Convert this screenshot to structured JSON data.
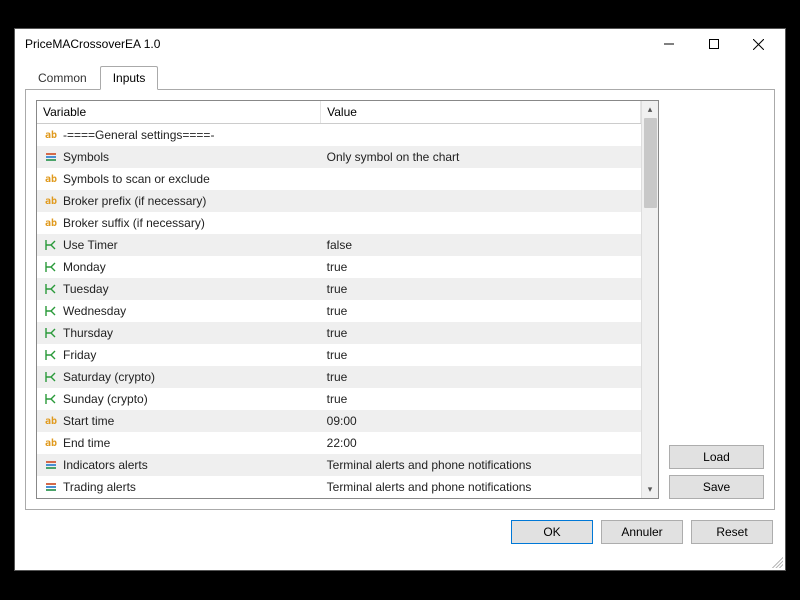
{
  "window": {
    "title": "PriceMACrossoverEA 1.0"
  },
  "tabs": {
    "common": "Common",
    "inputs": "Inputs"
  },
  "headers": {
    "variable": "Variable",
    "value": "Value"
  },
  "rows": [
    {
      "icon": "ab",
      "variable": "-====General settings====-",
      "value": ""
    },
    {
      "icon": "enum",
      "variable": "Symbols",
      "value": "Only symbol on the chart"
    },
    {
      "icon": "ab",
      "variable": "Symbols to scan or exclude",
      "value": ""
    },
    {
      "icon": "ab",
      "variable": "Broker prefix (if necessary)",
      "value": ""
    },
    {
      "icon": "ab",
      "variable": "Broker suffix (if necessary)",
      "value": ""
    },
    {
      "icon": "bool",
      "variable": "Use Timer",
      "value": "false"
    },
    {
      "icon": "bool",
      "variable": "Monday",
      "value": "true"
    },
    {
      "icon": "bool",
      "variable": "Tuesday",
      "value": "true"
    },
    {
      "icon": "bool",
      "variable": "Wednesday",
      "value": "true"
    },
    {
      "icon": "bool",
      "variable": "Thursday",
      "value": "true"
    },
    {
      "icon": "bool",
      "variable": "Friday",
      "value": "true"
    },
    {
      "icon": "bool",
      "variable": "Saturday (crypto)",
      "value": "true"
    },
    {
      "icon": "bool",
      "variable": "Sunday (crypto)",
      "value": "true"
    },
    {
      "icon": "ab",
      "variable": "Start time",
      "value": "09:00"
    },
    {
      "icon": "ab",
      "variable": "End time",
      "value": "22:00"
    },
    {
      "icon": "enum",
      "variable": "Indicators alerts",
      "value": "Terminal alerts and phone notifications"
    },
    {
      "icon": "enum",
      "variable": "Trading alerts",
      "value": "Terminal alerts and phone notifications"
    }
  ],
  "buttons": {
    "load": "Load",
    "save": "Save",
    "ok": "OK",
    "cancel": "Annuler",
    "reset": "Reset"
  }
}
